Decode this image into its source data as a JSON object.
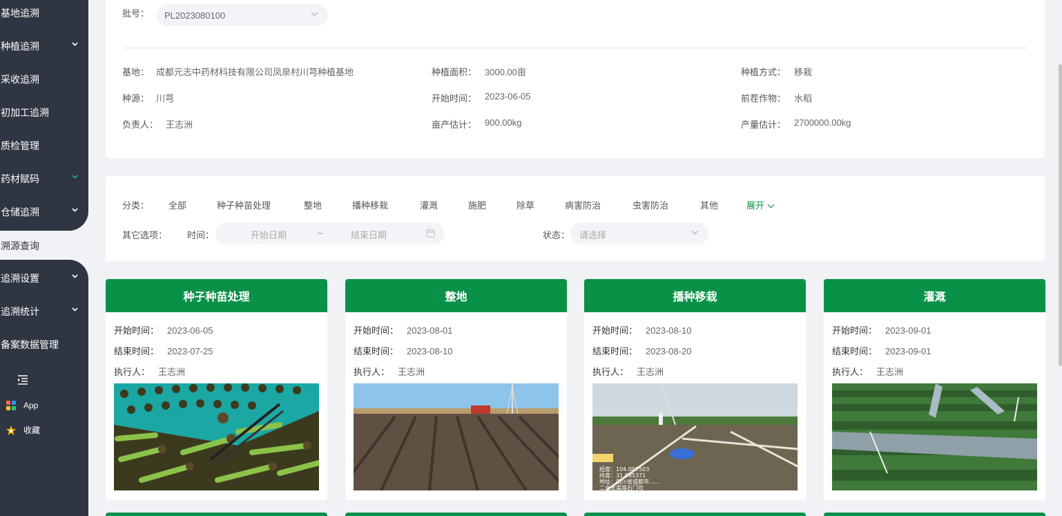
{
  "sidebar": {
    "items": [
      {
        "label": "基地追溯",
        "chevron": false
      },
      {
        "label": "种植追溯",
        "chevron": true
      },
      {
        "label": "采收追溯",
        "chevron": false
      },
      {
        "label": "初加工追溯",
        "chevron": false
      },
      {
        "label": "质检管理",
        "chevron": false
      },
      {
        "label": "药材赋码",
        "chevron": true,
        "chevron_color": "#19be6b"
      },
      {
        "label": "仓储追溯",
        "chevron": true
      },
      {
        "label": "追溯设置",
        "chevron": true
      },
      {
        "label": "追溯统计",
        "chevron": true
      },
      {
        "label": "备案数据管理",
        "chevron": false
      }
    ],
    "active_label": "溯源查询",
    "links": [
      {
        "label": "App",
        "icon": "apps-icon"
      },
      {
        "label": "收藏",
        "icon": "star-icon"
      }
    ]
  },
  "info": {
    "batch_label": "批号：",
    "batch_value": "PL2023080100",
    "fields": [
      {
        "label": "基地：",
        "value": "成都元志中药材科技有限公司凤泉村川芎种植基地"
      },
      {
        "label": "种植面积：",
        "value": "3000.00亩"
      },
      {
        "label": "种植方式：",
        "value": "移栽"
      },
      {
        "label": "种源：",
        "value": "川芎"
      },
      {
        "label": "开始时间：",
        "value": "2023-06-05"
      },
      {
        "label": "前茬作物：",
        "value": "水稻"
      },
      {
        "label": "负责人：",
        "value": "王志洲"
      },
      {
        "label": "亩产估计：",
        "value": "900.00kg"
      },
      {
        "label": "产量估计：",
        "value": "2700000.00kg"
      }
    ]
  },
  "filter": {
    "category_label": "分类：",
    "categories": [
      "全部",
      "种子种苗处理",
      "整地",
      "播种移栽",
      "灌溉",
      "施肥",
      "除草",
      "病害防治",
      "虫害防治",
      "其他"
    ],
    "expand_label": "展开",
    "other_label": "其它选项：",
    "time_label": "时间：",
    "start_placeholder": "开始日期",
    "separator": "~",
    "end_placeholder": "结束日期",
    "status_label": "状态：",
    "status_placeholder": "请选择"
  },
  "cards": [
    {
      "title": "种子种苗处理",
      "start_label": "开始时间：",
      "start": "2023-06-05",
      "end_label": "结束时间：",
      "end": "2023-07-25",
      "exec_label": "执行人：",
      "exec": "王志洲"
    },
    {
      "title": "整地",
      "start_label": "开始时间：",
      "start": "2023-08-01",
      "end_label": "结束时间：",
      "end": "2023-08-10",
      "exec_label": "执行人：",
      "exec": "王志洲"
    },
    {
      "title": "播种移栽",
      "start_label": "开始时间：",
      "start": "2023-08-10",
      "end_label": "结束时间：",
      "end": "2023-08-20",
      "exec_label": "执行人：",
      "exec": "王志洲"
    },
    {
      "title": "灌溉",
      "start_label": "开始时间：",
      "start": "2023-09-01",
      "end_label": "结束时间：",
      "end": "2023-09-01",
      "exec_label": "执行人：",
      "exec": "王志洲"
    }
  ],
  "photo3_overlay": [
    "经度：104.007503",
    "纬度：31.095371",
    "地址：四川省成都市……",
    "二合支渠路石门坎"
  ],
  "colors": {
    "sidebar": "#2f3542",
    "accent": "#0a9148"
  }
}
